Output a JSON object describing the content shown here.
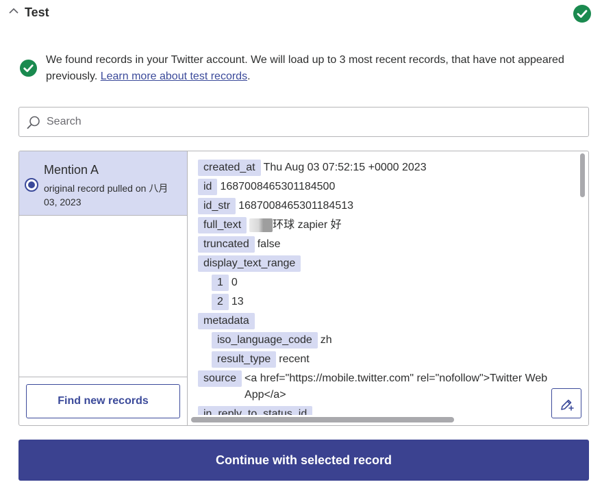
{
  "section": {
    "title": "Test",
    "collapse_icon": "chevron-up-icon",
    "status_icon": "check-circle-icon",
    "status_color": "#1a8a4f"
  },
  "info": {
    "icon": "check-circle-icon",
    "message": "We found records in your Twitter account. We will load up to 3 most recent records, that have not appeared previously. ",
    "link_text": "Learn more about test records",
    "trailing": "."
  },
  "search": {
    "icon": "search-icon",
    "placeholder": "Search",
    "value": ""
  },
  "records": [
    {
      "title": "Mention A",
      "subtitle": "original record pulled on 八月 03, 2023",
      "selected": true
    }
  ],
  "find_button_label": "Find new records",
  "record_data": {
    "rows": [
      {
        "key": "created_at",
        "value": "Thu Aug 03 07:52:15 +0000 2023"
      },
      {
        "key": "id",
        "value": "1687008465301184500"
      },
      {
        "key": "id_str",
        "value": "1687008465301184513"
      },
      {
        "key": "full_text",
        "value": "环球 zapier 好"
      },
      {
        "key": "truncated",
        "value": "false"
      },
      {
        "key": "display_text_range",
        "value": ""
      },
      {
        "key": "1",
        "value": "0"
      },
      {
        "key": "2",
        "value": "13"
      },
      {
        "key": "metadata",
        "value": ""
      },
      {
        "key": "iso_language_code",
        "value": "zh"
      },
      {
        "key": "result_type",
        "value": "recent"
      },
      {
        "key": "source",
        "value": "<a href=\"https://mobile.twitter.com\" rel=\"nofollow\">Twitter Web App</a>"
      },
      {
        "key": "in_reply_to_status_id",
        "value": ""
      }
    ]
  },
  "edit_button_icon": "edit-add-icon",
  "continue_button_label": "Continue with selected record",
  "colors": {
    "accent": "#3b4290",
    "pill_bg": "#d6daf2",
    "success": "#1a8a4f"
  }
}
